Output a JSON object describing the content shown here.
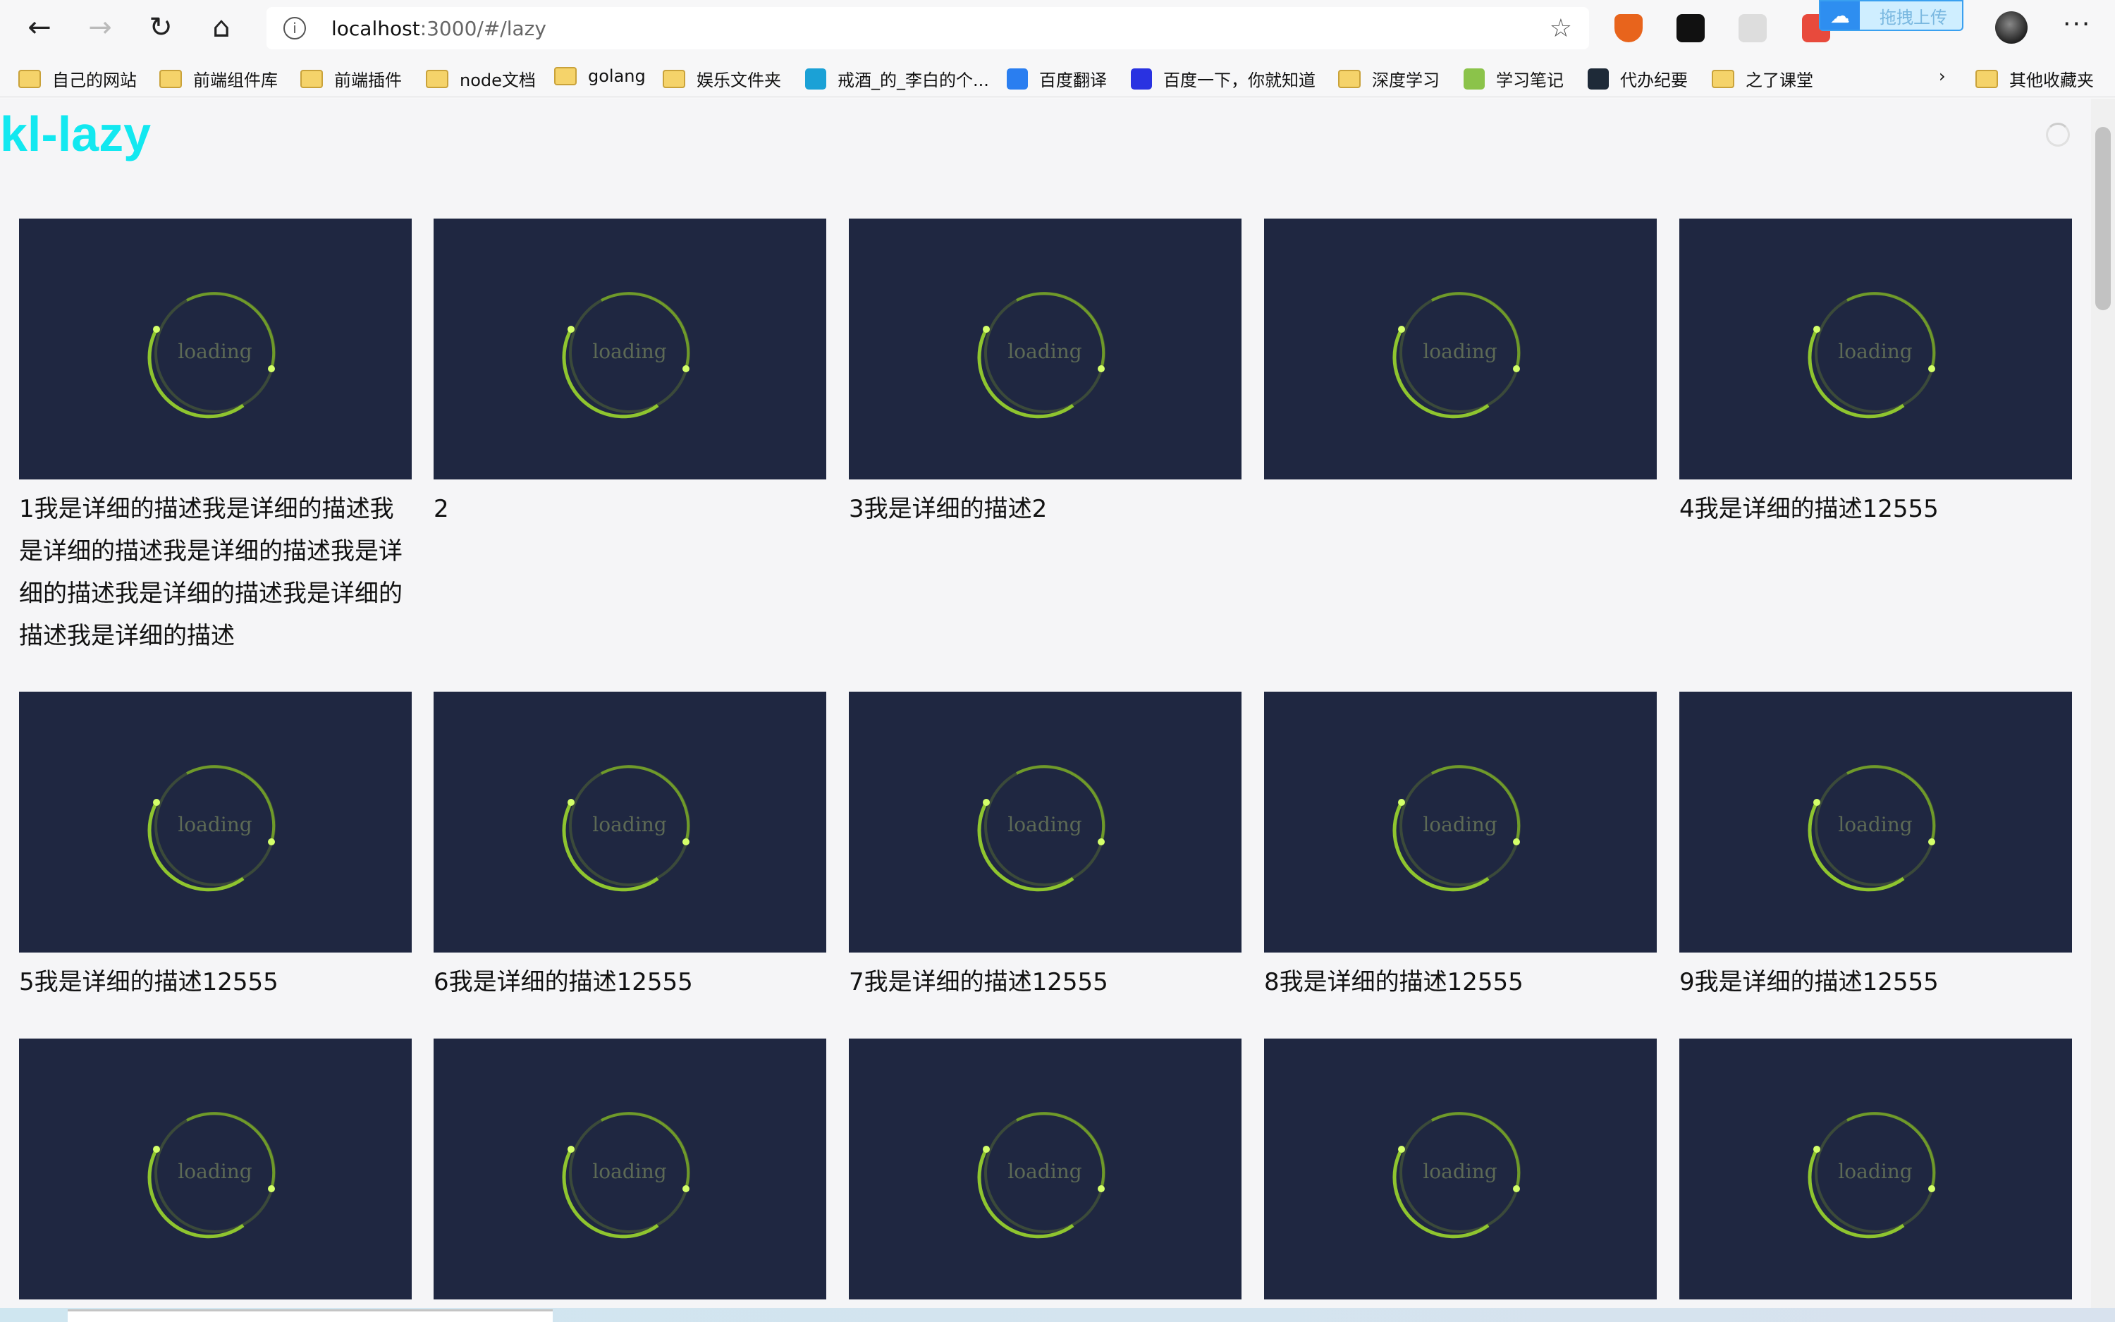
{
  "browser": {
    "url_host": "localhost",
    "url_rest": ":3000/#/lazy",
    "upload_label": "拖拽上传"
  },
  "bookmarks": [
    {
      "label": "自己的网站",
      "icon": "folder-icon"
    },
    {
      "label": "前端组件库",
      "icon": "folder-icon"
    },
    {
      "label": "前端插件",
      "icon": "folder-icon"
    },
    {
      "label": "node文档",
      "icon": "folder-icon"
    },
    {
      "label": "golang",
      "icon": "folder-icon"
    },
    {
      "label": "娱乐文件夹",
      "icon": "folder-icon"
    },
    {
      "label": "戒酒_的_李白的个...",
      "icon": "bilibili-icon"
    },
    {
      "label": "百度翻译",
      "icon": "translate-icon"
    },
    {
      "label": "百度一下，你就知道",
      "icon": "baidu-icon"
    },
    {
      "label": "深度学习",
      "icon": "folder-icon"
    },
    {
      "label": "学习笔记",
      "icon": "note-icon"
    },
    {
      "label": "代办纪要",
      "icon": "react-icon"
    },
    {
      "label": "之了课堂",
      "icon": "folder-icon"
    }
  ],
  "other_bookmarks": "其他收藏夹",
  "page": {
    "title": "kl-lazy",
    "loading_text": "loading",
    "cards": [
      "1我是详细的描述我是详细的描述我是详细的描述我是详细的描述我是详细的描述我是详细的描述我是详细的描述我是详细的描述",
      "2",
      "3我是详细的描述2",
      "",
      "4我是详细的描述12555",
      "5我是详细的描述12555",
      "6我是详细的描述12555",
      "7我是详细的描述12555",
      "8我是详细的描述12555",
      "9我是详细的描述12555",
      "",
      "",
      "",
      "",
      ""
    ]
  },
  "colors": {
    "accent": "#12e8f0",
    "tile": "#1f2741",
    "spinner": "#9acd32"
  }
}
